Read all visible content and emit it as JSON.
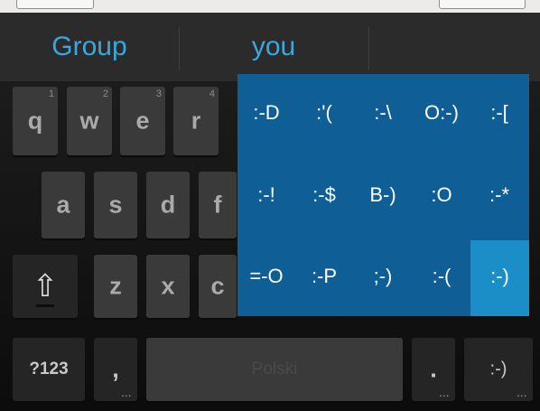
{
  "suggestions": [
    "Group",
    "you"
  ],
  "keys": {
    "row1": [
      {
        "label": "q",
        "hint": "1"
      },
      {
        "label": "w",
        "hint": "2"
      },
      {
        "label": "e",
        "hint": "3"
      },
      {
        "label": "r",
        "hint": "4"
      }
    ],
    "row2": [
      "a",
      "s",
      "d",
      "f"
    ],
    "row3": [
      "z",
      "x",
      "c"
    ],
    "shift": "⇧",
    "symbols": "?123",
    "comma": ",",
    "space": "Polski",
    "period": ".",
    "emoticon": ":-)",
    "more_dots": "..."
  },
  "emoticons": [
    [
      ":-D",
      ":'(",
      ":-\\",
      "O:-)",
      ":-["
    ],
    [
      ":-!",
      ":-$",
      "B-)",
      ":O",
      ":-*"
    ],
    [
      "=-O",
      ":-P",
      ";-)",
      ":-(",
      ":-)"
    ]
  ],
  "selected_emoticon": ":-)",
  "colors": {
    "suggestion": "#3aa8df",
    "popup": "#0f5f96",
    "popup_selected": "#1b8ec8"
  }
}
